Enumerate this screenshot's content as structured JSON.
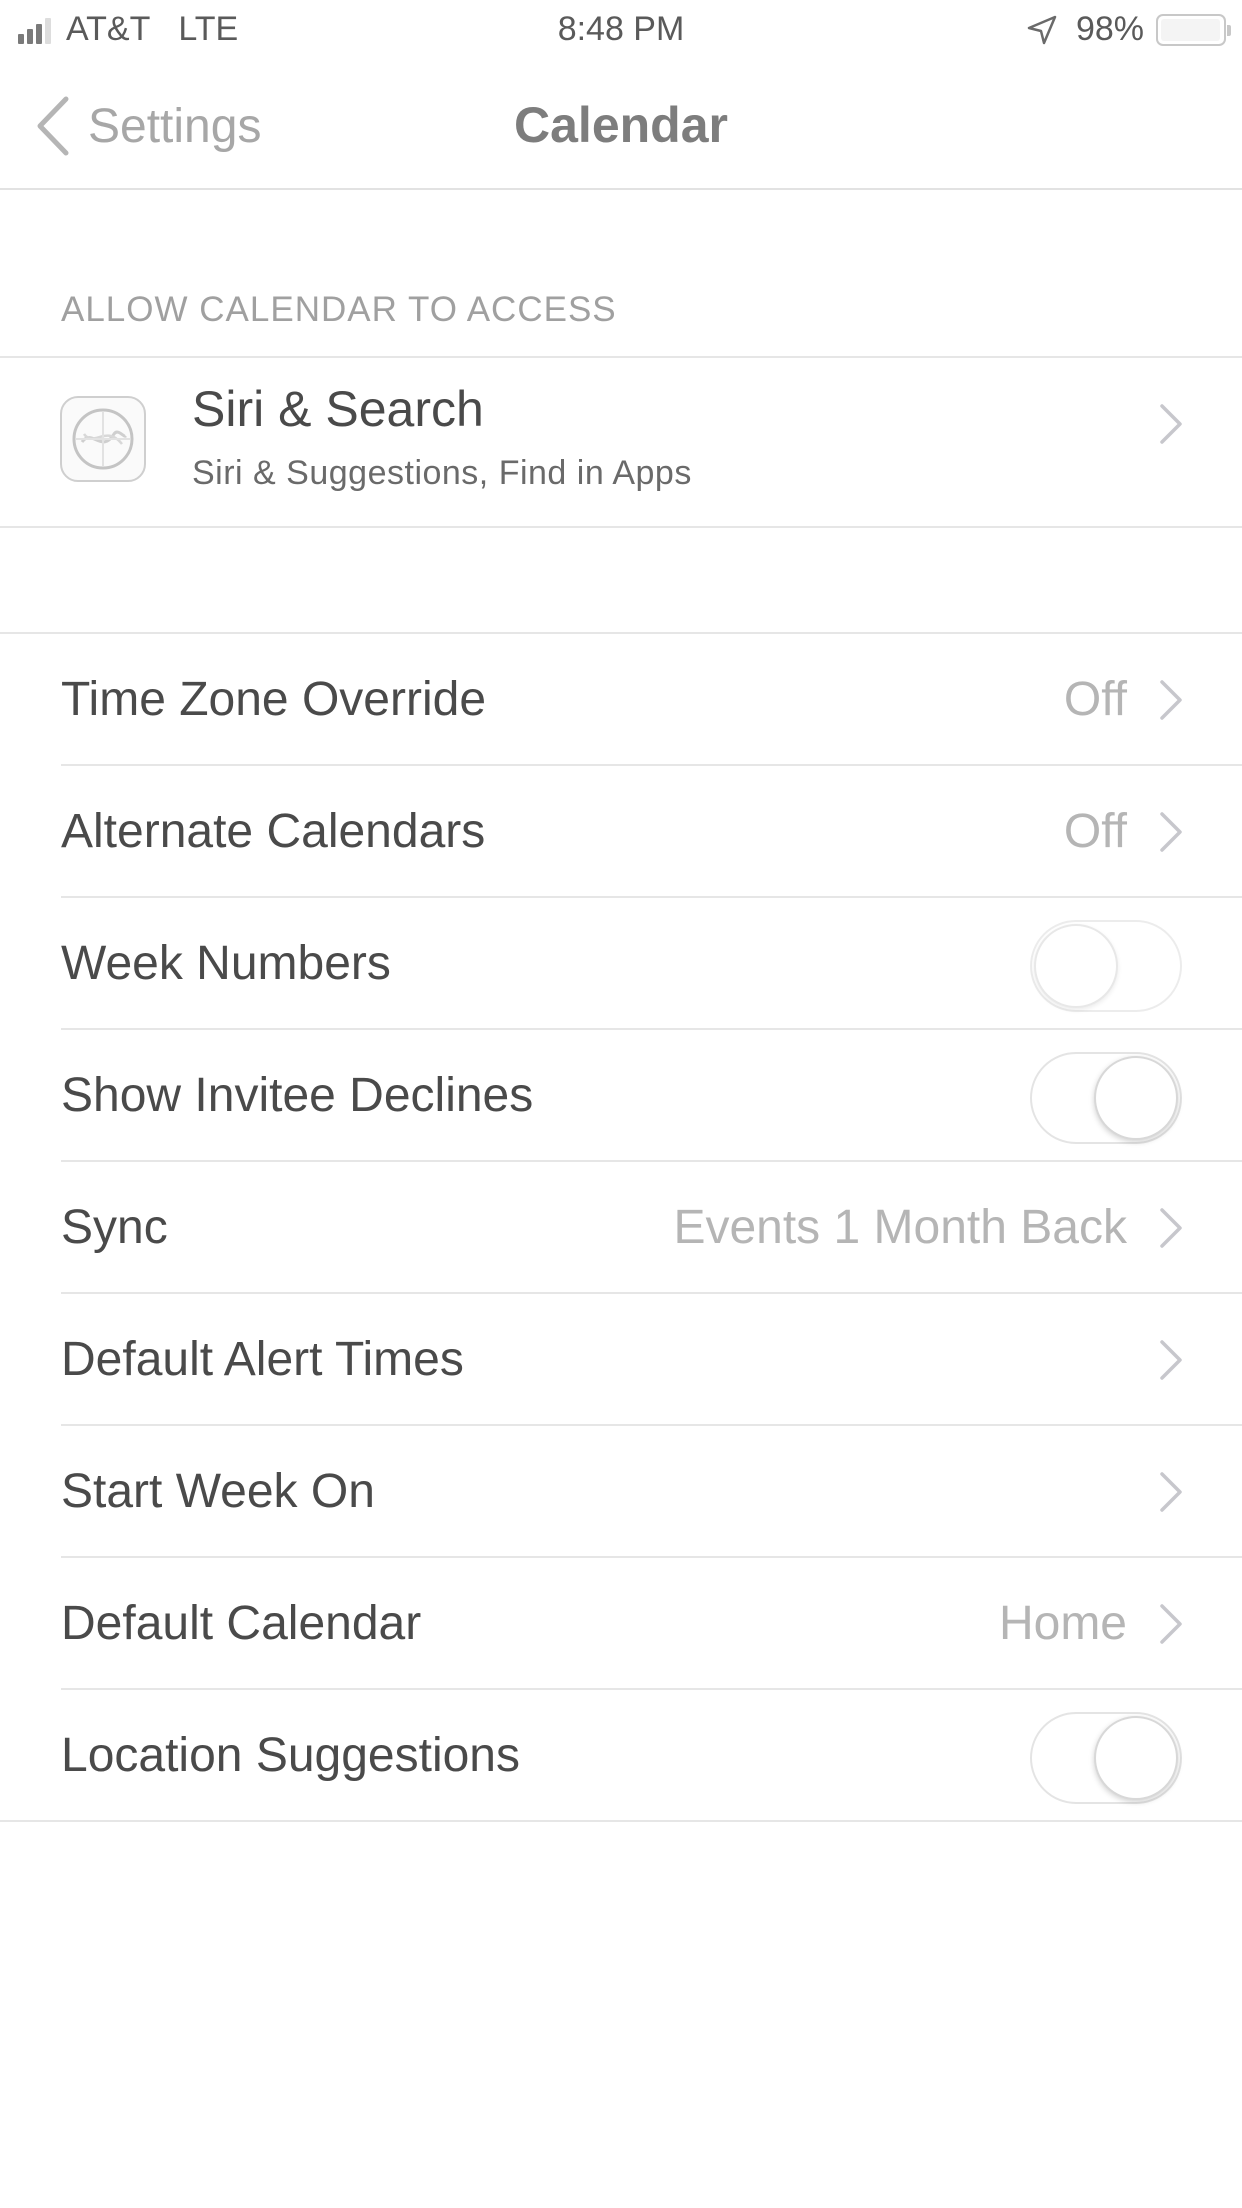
{
  "status_bar": {
    "carrier": "AT&T",
    "network": "LTE",
    "time": "8:48 PM",
    "battery_percent": "98%",
    "battery_level": 0.98,
    "signal_bars": 4,
    "signal_bars_filled": 3,
    "icons": [
      "signal-icon",
      "location-arrow-icon",
      "battery-icon"
    ]
  },
  "nav": {
    "back_label": "Settings",
    "title": "Calendar"
  },
  "access_section": {
    "header": "ALLOW CALENDAR TO ACCESS",
    "siri_title": "Siri & Search",
    "siri_subtitle": "Siri & Suggestions, Find in Apps",
    "icon": "siri-icon"
  },
  "rows": [
    {
      "label": "Time Zone Override",
      "value": "Off",
      "type": "disclosure"
    },
    {
      "label": "Alternate Calendars",
      "value": "Off",
      "type": "disclosure"
    },
    {
      "label": "Week Numbers",
      "type": "toggle",
      "on": false
    },
    {
      "label": "Show Invitee Declines",
      "type": "toggle",
      "on": false
    },
    {
      "label": "Sync",
      "value": "Events 1 Month Back",
      "type": "disclosure"
    },
    {
      "label": "Default Alert Times",
      "value": "",
      "type": "disclosure"
    },
    {
      "label": "Start Week On",
      "value": "",
      "type": "disclosure"
    },
    {
      "label": "Default Calendar",
      "value": "Home",
      "type": "disclosure"
    },
    {
      "label": "Location Suggestions",
      "type": "toggle",
      "on": false
    }
  ],
  "colors": {
    "separator": "#e6e6e6",
    "label": "#4a4a4a",
    "secondary": "#b5b5b5",
    "title": "#7d7d7d"
  }
}
